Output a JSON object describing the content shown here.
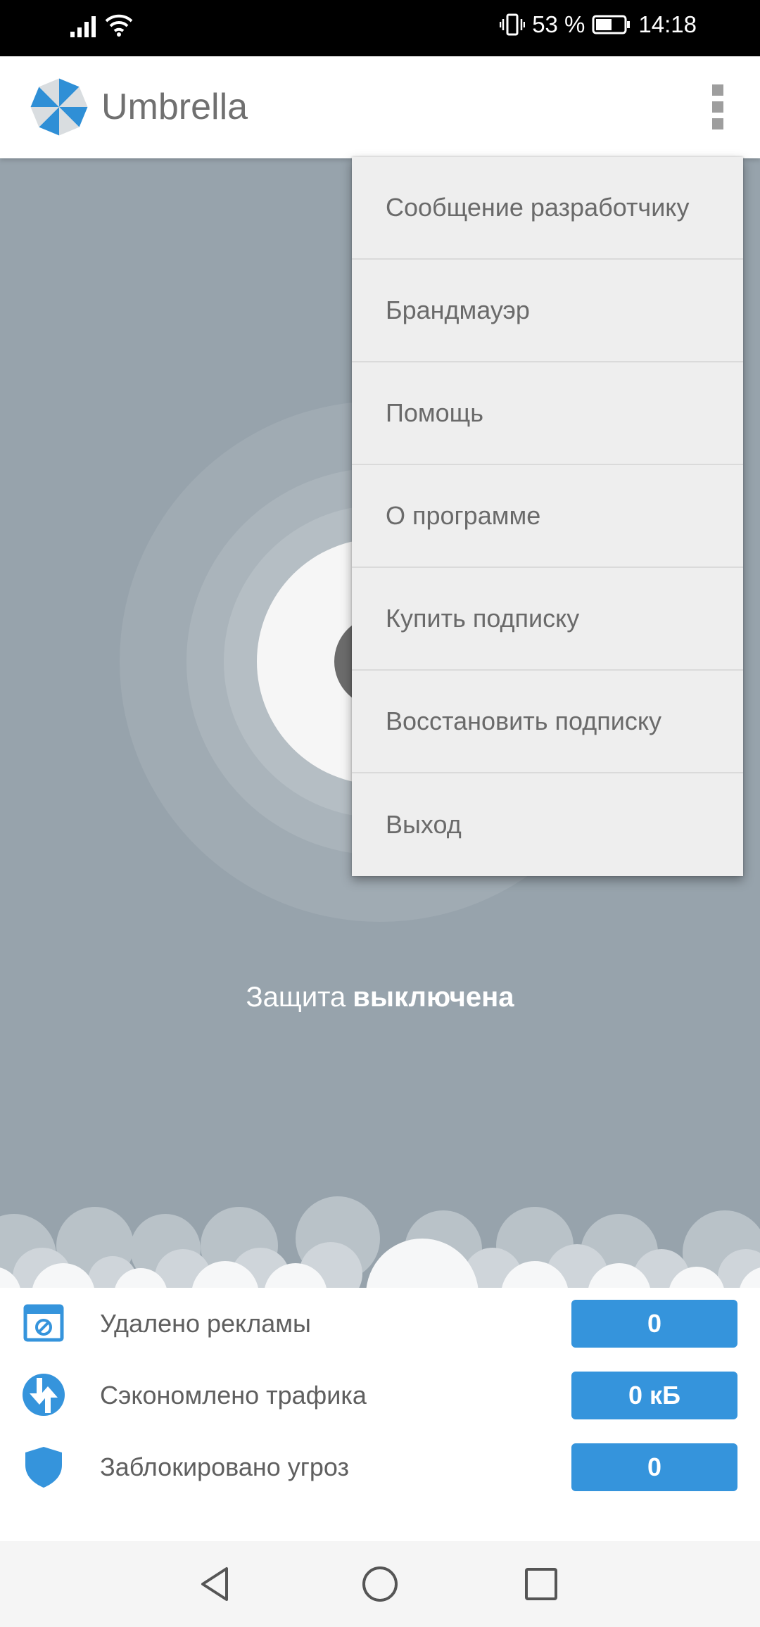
{
  "status_bar": {
    "battery": "53 %",
    "time": "14:18",
    "icons": [
      "signal-icon",
      "wifi-icon",
      "vibrate-icon",
      "battery-icon"
    ]
  },
  "app_bar": {
    "title": "Umbrella",
    "logo_icon": "umbrella-logo-icon",
    "menu_icon": "more-vert-icon"
  },
  "main": {
    "protection_text": "Защита",
    "protection_state": "выключена",
    "power_icon": "power-icon"
  },
  "menu": {
    "items": [
      {
        "label": "Сообщение разработчику"
      },
      {
        "label": "Брандмауэр"
      },
      {
        "label": "Помощь"
      },
      {
        "label": "О программе"
      },
      {
        "label": "Купить подписку"
      },
      {
        "label": "Восстановить подписку"
      },
      {
        "label": "Выход"
      }
    ]
  },
  "stats": [
    {
      "icon": "ads-blocked-icon",
      "label": "Удалено рекламы",
      "value": "0"
    },
    {
      "icon": "traffic-saved-icon",
      "label": "Сэкономлено трафика",
      "value": "0 кБ"
    },
    {
      "icon": "shield-icon",
      "label": "Заблокировано угроз",
      "value": "0"
    }
  ],
  "nav_bar": {
    "icons": [
      "back-icon",
      "home-icon",
      "recents-icon"
    ]
  },
  "colors": {
    "accent": "#3594dc",
    "background": "#97a3ac",
    "menu_background": "#eeeeee"
  }
}
